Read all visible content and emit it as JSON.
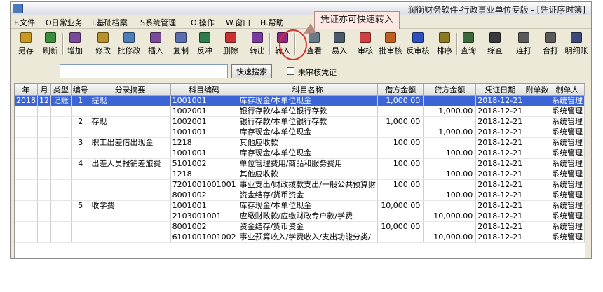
{
  "window": {
    "title": "润衡财务软件-行政事业单位专版 - [凭证序时簿]"
  },
  "menu": [
    "F.文件",
    "O日常业务",
    "I.基础档案",
    "S系统管理",
    "O.操作",
    "W.窗口",
    "H.帮助"
  ],
  "toolbar": [
    {
      "label": "另存",
      "icon": "save-as-icon",
      "color": "#c89a20"
    },
    {
      "label": "刷新",
      "icon": "refresh-icon",
      "color": "#3a8f3a"
    },
    {
      "label": "增加",
      "icon": "add-icon",
      "color": "#7a4a9a"
    },
    {
      "label": "修改",
      "icon": "edit-icon",
      "color": "#b8902a"
    },
    {
      "label": "批修改",
      "icon": "batch-edit-icon",
      "color": "#4a7fb8"
    },
    {
      "label": "插入",
      "icon": "insert-icon",
      "color": "#7a4a9a"
    },
    {
      "label": "复制",
      "icon": "copy-icon",
      "color": "#5a6fb0"
    },
    {
      "label": "反冲",
      "icon": "reverse-icon",
      "color": "#2e7d4f"
    },
    {
      "label": "删除",
      "icon": "delete-icon",
      "color": "#cc3030"
    },
    {
      "label": "转出",
      "icon": "transfer-out-icon",
      "color": "#7a3aa0"
    },
    {
      "label": "转入",
      "icon": "transfer-in-icon",
      "color": "#8a2a8a"
    },
    {
      "label": "查看",
      "icon": "view-icon",
      "color": "#6a7a8a"
    },
    {
      "label": "易入",
      "icon": "easy-entry-icon",
      "color": "#4a5a6a"
    },
    {
      "label": "审核",
      "icon": "review-icon",
      "color": "#d04040"
    },
    {
      "label": "批审核",
      "icon": "batch-review-icon",
      "color": "#c06020"
    },
    {
      "label": "反审核",
      "icon": "unreview-icon",
      "color": "#3050c0"
    },
    {
      "label": "排序",
      "icon": "sort-icon",
      "color": "#8a7a20"
    },
    {
      "label": "查询",
      "icon": "query-icon",
      "color": "#3a6a3a"
    },
    {
      "label": "综查",
      "icon": "binoculars-icon",
      "color": "#3a3a3a"
    },
    {
      "label": "连打",
      "icon": "print-icon",
      "color": "#5a5a5a"
    },
    {
      "label": "合打",
      "icon": "combined-print-icon",
      "color": "#5a5a5a"
    },
    {
      "label": "明细账",
      "icon": "ledger-icon",
      "color": "#3a4a7a"
    }
  ],
  "search": {
    "placeholder": "",
    "button_label": "快速搜索",
    "checkbox_label": "未审核凭证"
  },
  "callout": {
    "text": "凭证亦可快速转入"
  },
  "grid": {
    "columns": [
      "年",
      "月",
      "类型",
      "编号",
      "分录摘要",
      "科目编码",
      "科目名称",
      "借方金额",
      "贷方金额",
      "凭证日期",
      "附单数",
      "制单人"
    ],
    "rows": [
      [
        "2018",
        "12",
        "记账",
        "1",
        "提现",
        "1001001",
        "库存现金/本单位现金",
        "1,000.00",
        "",
        "2018-12-21",
        "",
        "系统管理"
      ],
      [
        "",
        "",
        "",
        "",
        "",
        "1002001",
        "银行存款/本单位银行存款",
        "",
        "1,000.00",
        "2018-12-21",
        "",
        "系统管理"
      ],
      [
        "",
        "",
        "",
        "2",
        "存现",
        "1002001",
        "银行存款/本单位银行存款",
        "1,000.00",
        "",
        "2018-12-21",
        "",
        "系统管理"
      ],
      [
        "",
        "",
        "",
        "",
        "",
        "1001001",
        "库存现金/本单位现金",
        "",
        "1,000.00",
        "2018-12-21",
        "",
        "系统管理"
      ],
      [
        "",
        "",
        "",
        "3",
        "职工出差借出现金",
        "1218",
        "其他应收款",
        "100.00",
        "",
        "2018-12-21",
        "",
        "系统管理"
      ],
      [
        "",
        "",
        "",
        "",
        "",
        "1001001",
        "库存现金/本单位现金",
        "",
        "100.00",
        "2018-12-21",
        "",
        "系统管理"
      ],
      [
        "",
        "",
        "",
        "4",
        "出差人员报销差旅费",
        "5101002",
        "单位管理费用/商品和服务费用",
        "100.00",
        "",
        "2018-12-21",
        "",
        "系统管理"
      ],
      [
        "",
        "",
        "",
        "",
        "",
        "1218",
        "其他应收款",
        "",
        "100.00",
        "2018-12-21",
        "",
        "系统管理"
      ],
      [
        "",
        "",
        "",
        "",
        "",
        "7201001001001",
        "事业支出/财政拨款支出/一般公共预算财",
        "100.00",
        "",
        "2018-12-21",
        "",
        "系统管理"
      ],
      [
        "",
        "",
        "",
        "",
        "",
        "8001002",
        "资金结存/货币资金",
        "",
        "100.00",
        "2018-12-21",
        "",
        "系统管理"
      ],
      [
        "",
        "",
        "",
        "5",
        "收学费",
        "1001001",
        "库存现金/本单位现金",
        "10,000.00",
        "",
        "2018-12-21",
        "",
        "系统管理"
      ],
      [
        "",
        "",
        "",
        "",
        "",
        "2103001001",
        "应缴财政款/应缴财政专户款/学费",
        "",
        "10,000.00",
        "2018-12-21",
        "",
        "系统管理"
      ],
      [
        "",
        "",
        "",
        "",
        "",
        "8001002",
        "资金结存/货币资金",
        "10,000.00",
        "",
        "2018-12-21",
        "",
        "系统管理"
      ],
      [
        "",
        "",
        "",
        "",
        "",
        "6101001001002",
        "事业预算收入/学费收入/支出功能分类/",
        "",
        "10,000.00",
        "2018-12-21",
        "",
        "系统管理"
      ]
    ]
  }
}
